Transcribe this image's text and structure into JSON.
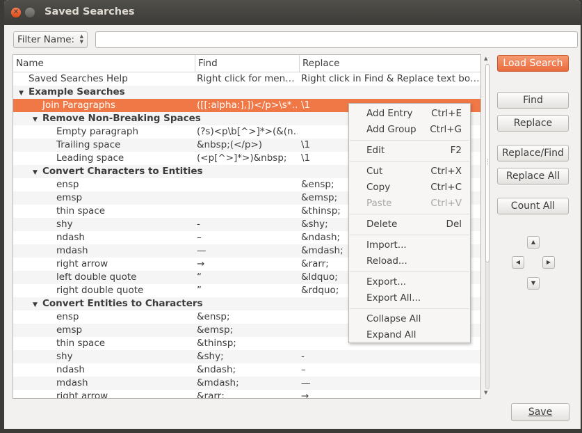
{
  "window": {
    "title": "Saved Searches"
  },
  "filter": {
    "label": "Filter Name:",
    "value": ""
  },
  "columns": [
    "Name",
    "Find",
    "Replace"
  ],
  "rows": [
    {
      "name": "Saved Searches Help",
      "find": "Right click for men…",
      "replace": "Right click in Find & Replace text bo…",
      "level": 0,
      "arrow": "",
      "group": false
    },
    {
      "name": "Example Searches",
      "find": "",
      "replace": "",
      "level": 0,
      "arrow": "▼",
      "group": true
    },
    {
      "name": "Join Paragraphs",
      "find": "([[:alpha:],])</p>\\s*…",
      "replace": "\\1",
      "level": 1,
      "arrow": "",
      "group": false,
      "selected": true
    },
    {
      "name": "Remove Non-Breaking Spaces",
      "find": "",
      "replace": "",
      "level": 1,
      "arrow": "▼",
      "group": true
    },
    {
      "name": "Empty paragraph",
      "find": "(?s)<p\\b[^>]*>(&(n…",
      "replace": "",
      "level": 2,
      "arrow": "",
      "group": false
    },
    {
      "name": "Trailing space",
      "find": "&nbsp;(</p>)",
      "replace": "\\1",
      "level": 2,
      "arrow": "",
      "group": false
    },
    {
      "name": "Leading space",
      "find": "(<p[^>]*>)&nbsp;",
      "replace": "\\1",
      "level": 2,
      "arrow": "",
      "group": false
    },
    {
      "name": "Convert Characters to Entities",
      "find": "",
      "replace": "",
      "level": 1,
      "arrow": "▼",
      "group": true
    },
    {
      "name": "ensp",
      "find": " ",
      "replace": "&ensp;",
      "level": 2,
      "arrow": "",
      "group": false
    },
    {
      "name": "emsp",
      "find": " ",
      "replace": "&emsp;",
      "level": 2,
      "arrow": "",
      "group": false
    },
    {
      "name": "thin space",
      "find": " ",
      "replace": "&thinsp;",
      "level": 2,
      "arrow": "",
      "group": false
    },
    {
      "name": "shy",
      "find": "-",
      "replace": "&shy;",
      "level": 2,
      "arrow": "",
      "group": false
    },
    {
      "name": "ndash",
      "find": "–",
      "replace": "&ndash;",
      "level": 2,
      "arrow": "",
      "group": false
    },
    {
      "name": "mdash",
      "find": "—",
      "replace": "&mdash;",
      "level": 2,
      "arrow": "",
      "group": false
    },
    {
      "name": "right arrow",
      "find": "→",
      "replace": "&rarr;",
      "level": 2,
      "arrow": "",
      "group": false
    },
    {
      "name": "left double quote",
      "find": "“",
      "replace": "&ldquo;",
      "level": 2,
      "arrow": "",
      "group": false
    },
    {
      "name": "right double quote",
      "find": "”",
      "replace": "&rdquo;",
      "level": 2,
      "arrow": "",
      "group": false
    },
    {
      "name": "Convert Entities to Characters",
      "find": "",
      "replace": "",
      "level": 1,
      "arrow": "▼",
      "group": true
    },
    {
      "name": "ensp",
      "find": "&ensp;",
      "replace": " ",
      "level": 2,
      "arrow": "",
      "group": false
    },
    {
      "name": "emsp",
      "find": "&emsp;",
      "replace": " ",
      "level": 2,
      "arrow": "",
      "group": false
    },
    {
      "name": "thin space",
      "find": "&thinsp;",
      "replace": " ",
      "level": 2,
      "arrow": "",
      "group": false
    },
    {
      "name": "shy",
      "find": "&shy;",
      "replace": "-",
      "level": 2,
      "arrow": "",
      "group": false
    },
    {
      "name": "ndash",
      "find": "&ndash;",
      "replace": "–",
      "level": 2,
      "arrow": "",
      "group": false
    },
    {
      "name": "mdash",
      "find": "&mdash;",
      "replace": "—",
      "level": 2,
      "arrow": "",
      "group": false
    },
    {
      "name": "right arrow",
      "find": "&rarr;",
      "replace": "→",
      "level": 2,
      "arrow": "",
      "group": false
    }
  ],
  "buttons": {
    "load_search": "Load Search",
    "find": "Find",
    "replace": "Replace",
    "replace_find": "Replace/Find",
    "replace_all": "Replace All",
    "count_all": "Count All",
    "save": "Save"
  },
  "context_menu": [
    {
      "label": "Add Entry",
      "accel": "Ctrl+E",
      "enabled": true
    },
    {
      "label": "Add Group",
      "accel": "Ctrl+G",
      "enabled": true
    },
    {
      "separator": true
    },
    {
      "label": "Edit",
      "accel": "F2",
      "enabled": true
    },
    {
      "separator": true
    },
    {
      "label": "Cut",
      "accel": "Ctrl+X",
      "enabled": true
    },
    {
      "label": "Copy",
      "accel": "Ctrl+C",
      "enabled": true
    },
    {
      "label": "Paste",
      "accel": "Ctrl+V",
      "enabled": false
    },
    {
      "separator": true
    },
    {
      "label": "Delete",
      "accel": "Del",
      "enabled": true
    },
    {
      "separator": true
    },
    {
      "label": "Import...",
      "accel": "",
      "enabled": true
    },
    {
      "label": "Reload...",
      "accel": "",
      "enabled": true
    },
    {
      "separator": true
    },
    {
      "label": "Export...",
      "accel": "",
      "enabled": true
    },
    {
      "label": "Export All...",
      "accel": "",
      "enabled": true
    },
    {
      "separator": true
    },
    {
      "label": "Collapse All",
      "accel": "",
      "enabled": true
    },
    {
      "label": "Expand All",
      "accel": "",
      "enabled": true
    }
  ],
  "colors": {
    "accent": "#f07746",
    "titlebar": "#3c3b37",
    "window_bg": "#f2f1f0"
  },
  "icons": {
    "close": "close-icon",
    "maximize": "maximize-icon",
    "up": "arrow-up-icon",
    "down": "arrow-down-icon",
    "left": "arrow-left-icon",
    "right": "arrow-right-icon"
  }
}
